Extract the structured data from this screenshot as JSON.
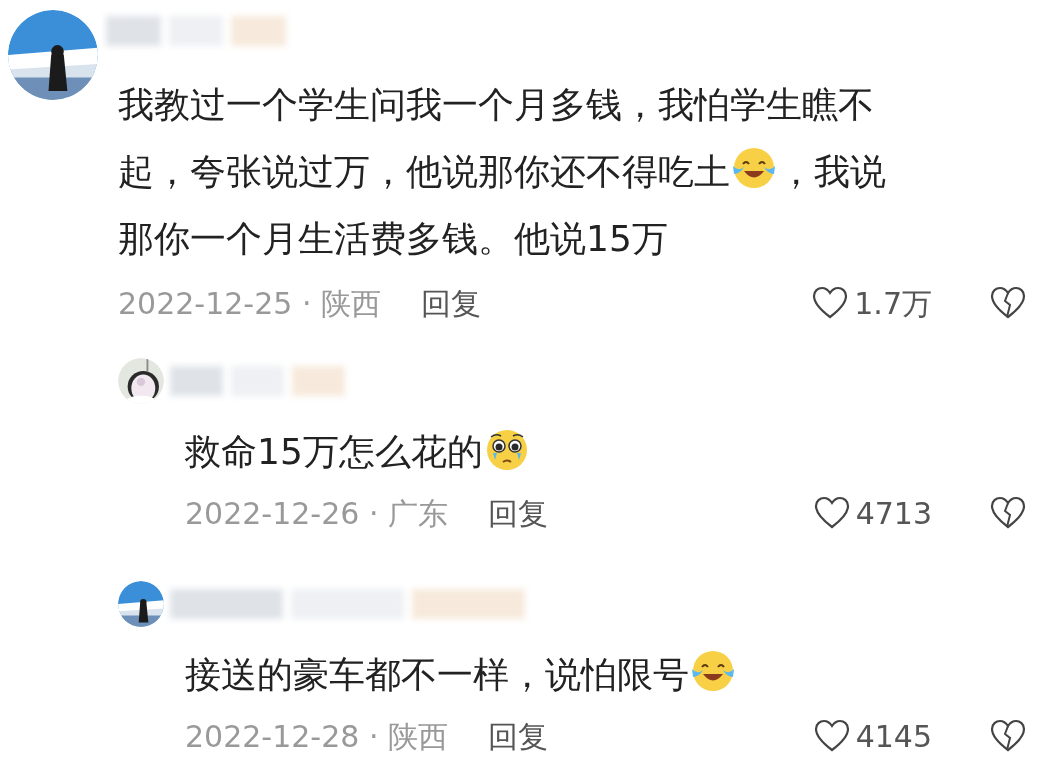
{
  "comments": [
    {
      "kind": "top",
      "lines": [
        [
          {
            "kind": "text",
            "text": "我教过一个学生问我一个月多钱，我怕学生瞧不"
          }
        ],
        [
          {
            "kind": "text",
            "text": "起，夸张说过万，他说那你还不得吃土"
          },
          {
            "kind": "laugh_cry_emoji"
          },
          {
            "kind": "text",
            "text": "，我说"
          }
        ],
        [
          {
            "kind": "text",
            "text": "那你一个月生活费多钱。他说15万"
          }
        ]
      ],
      "meta": "2022-12-25 · 陕西",
      "reply": "回复",
      "likes": "1.7万"
    },
    {
      "kind": "reply",
      "lines": [
        [
          {
            "kind": "text",
            "text": "救命15万怎么花的"
          },
          {
            "kind": "pleading_emoji"
          }
        ]
      ],
      "meta": "2022-12-26 · 广东",
      "reply": "回复",
      "likes": "4713"
    },
    {
      "kind": "reply",
      "lines": [
        [
          {
            "kind": "text",
            "text": "接送的豪车都不一样，说怕限号"
          },
          {
            "kind": "laugh_cry_emoji"
          }
        ]
      ],
      "meta": "2022-12-28 · 陕西",
      "reply": "回复",
      "likes": "4145"
    }
  ]
}
